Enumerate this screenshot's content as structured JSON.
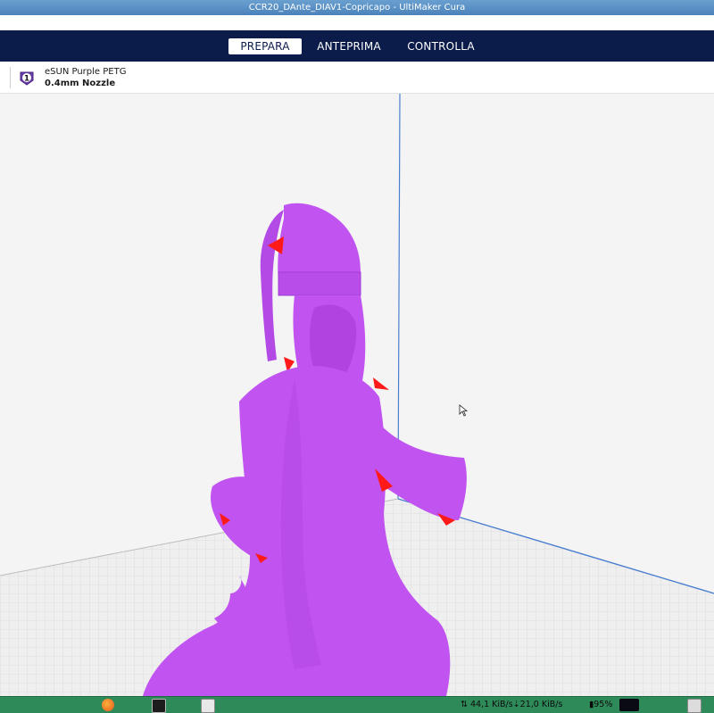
{
  "window": {
    "title": "CCR20_DAnte_DIAV1-Copricapo - UltiMaker Cura"
  },
  "stages": {
    "prepare": "PREPARA",
    "preview": "ANTEPRIMA",
    "monitor": "CONTROLLA"
  },
  "extruder": {
    "number": "1",
    "material": "eSUN Purple PETG",
    "nozzle": "0.4mm Nozzle"
  },
  "taskbar": {
    "network": "44,1 KiB/s",
    "network2": "21,0 KiB/s",
    "battery": "95%"
  },
  "colors": {
    "stage_bg": "#0b1b4a",
    "model": "#c153f0",
    "overhang": "#ff1a1a",
    "taskbar": "#2f8a5a"
  }
}
